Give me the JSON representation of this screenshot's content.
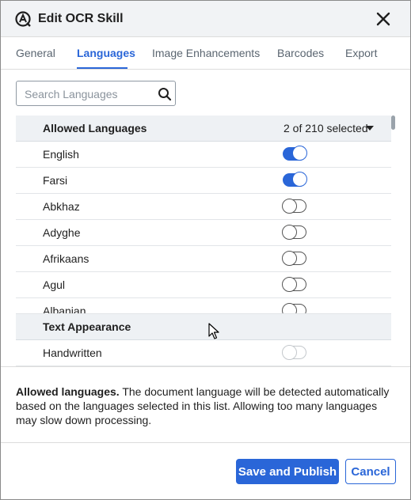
{
  "dialog": {
    "title": "Edit OCR Skill"
  },
  "icons": {
    "logo": "product-logo-icon",
    "close": "close-icon",
    "search": "search-icon",
    "caret": "caret-down-icon"
  },
  "colors": {
    "accent": "#2a66d8",
    "header_bg": "#f1f3f5",
    "group_bg": "#eef1f4"
  },
  "tabs": [
    {
      "label": "General",
      "active": false
    },
    {
      "label": "Languages",
      "active": true
    },
    {
      "label": "Image Enhancements",
      "active": false
    },
    {
      "label": "Barcodes",
      "active": false
    },
    {
      "label": "Export",
      "active": false
    }
  ],
  "search": {
    "placeholder": "Search Languages",
    "value": ""
  },
  "languages": {
    "header": "Allowed Languages",
    "selected_count": "2 of 210 selected",
    "items": [
      {
        "label": "English",
        "enabled": true
      },
      {
        "label": "Farsi",
        "enabled": true
      },
      {
        "label": "Abkhaz",
        "enabled": false
      },
      {
        "label": "Adyghe",
        "enabled": false
      },
      {
        "label": "Afrikaans",
        "enabled": false
      },
      {
        "label": "Agul",
        "enabled": false
      },
      {
        "label": "Albanian",
        "enabled": false
      }
    ]
  },
  "text_appearance": {
    "header": "Text Appearance",
    "items": [
      {
        "label": "Handwritten",
        "enabled": false,
        "disabled": true
      }
    ]
  },
  "description": {
    "bold": "Allowed languages.",
    "text": "The document language will be detected automatically based on the languages selected in this list. Allowing too many languages may slow down processing."
  },
  "footer": {
    "primary": "Save and Publish",
    "secondary": "Cancel"
  }
}
